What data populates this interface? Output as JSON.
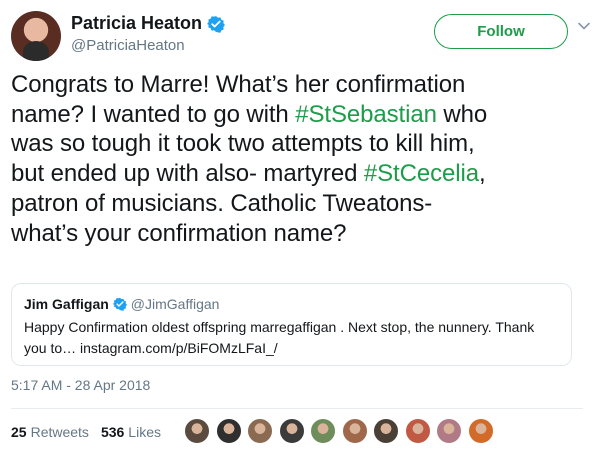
{
  "author": {
    "name": "Patricia Heaton",
    "handle": "@PatriciaHeaton",
    "verified_icon": "verified-badge-icon",
    "avatar": "profile-photo"
  },
  "follow_button": {
    "label": "Follow"
  },
  "tweet": {
    "lines": [
      [
        {
          "text": "Congrats to Marre! What’s her confirmation"
        }
      ],
      [
        {
          "text": "name? I wanted to go with "
        },
        {
          "text": "#StSebastian",
          "hashtag": true
        },
        {
          "text": " who"
        }
      ],
      [
        {
          "text": "was so tough it took two attempts to kill him,"
        }
      ],
      [
        {
          "text": "but ended up with also- martyred "
        },
        {
          "text": "#StCecelia",
          "hashtag": true
        },
        {
          "text": ","
        }
      ],
      [
        {
          "text": "patron of musicians.  Catholic Tweatons-"
        }
      ],
      [
        {
          "text": "what’s your confirmation name?"
        }
      ]
    ]
  },
  "quoted_tweet": {
    "name": "Jim Gaffigan",
    "handle": "@JimGaffigan",
    "line1": "Happy Confirmation oldest offspring marregaffigan .  Next stop, the nunnery.  Thank",
    "line2": "you to… instagram.com/p/BiFOMzLFaI_/"
  },
  "timestamp": "5:17 AM - 28 Apr 2018",
  "stats": {
    "retweets_count": "25",
    "retweets_label": "Retweets",
    "likes_count": "536",
    "likes_label": "Likes"
  },
  "likers": [
    {
      "color": "#5b4a3e"
    },
    {
      "color": "#2f2f2f"
    },
    {
      "color": "#8a6b52"
    },
    {
      "color": "#3b3b3b"
    },
    {
      "color": "#6f8d5a"
    },
    {
      "color": "#a0684b"
    },
    {
      "color": "#4a4036"
    },
    {
      "color": "#c05a44"
    },
    {
      "color": "#b07a86"
    },
    {
      "color": "#d26a2a"
    }
  ],
  "colors": {
    "accent_green": "#1d9c4a",
    "verified_blue": "#1da1f2",
    "secondary_text": "#657786"
  }
}
